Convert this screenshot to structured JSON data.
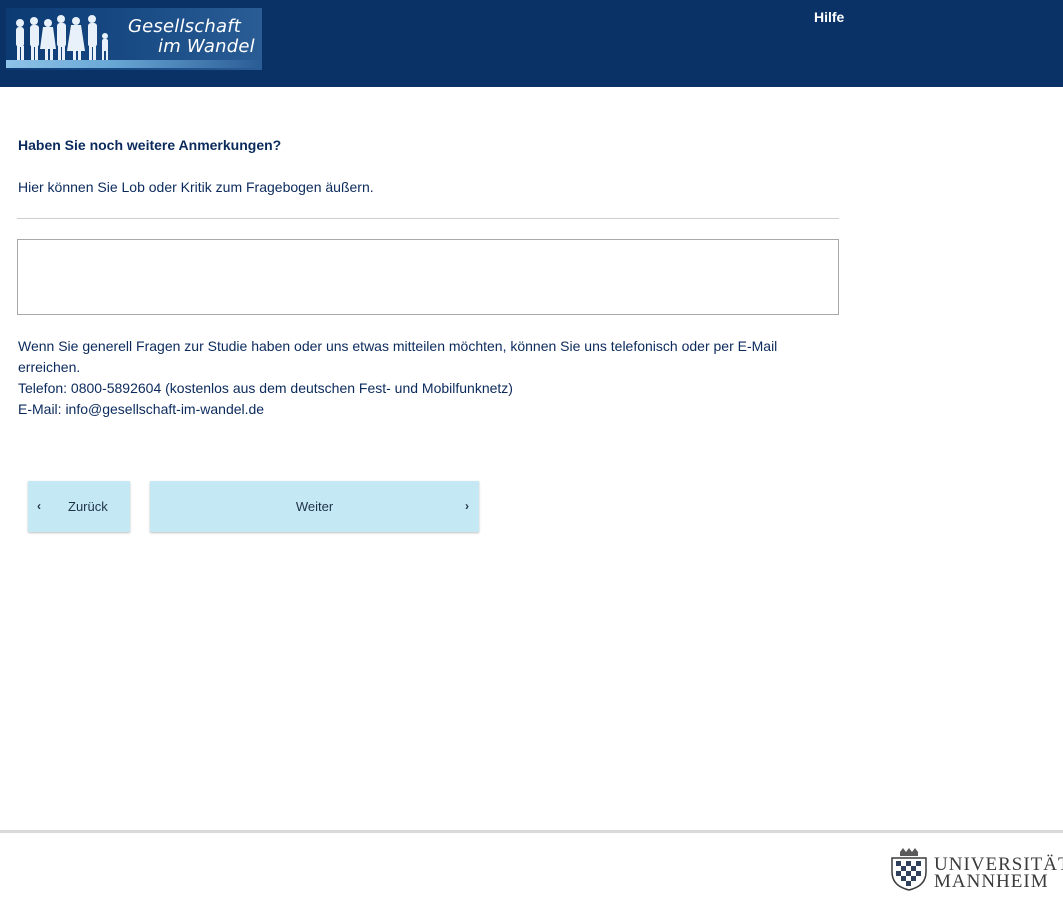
{
  "header": {
    "logo_line1": "Gesellschaft",
    "logo_line2": "im Wandel",
    "help_label": "Hilfe"
  },
  "question": {
    "title": "Haben Sie noch weitere Anmerkungen?",
    "subtitle": "Hier können Sie Lob oder Kritik zum Fragebogen äußern.",
    "comment_value": ""
  },
  "info": {
    "line1": "Wenn Sie generell Fragen zur Studie haben oder uns etwas mitteilen möchten, können Sie uns telefonisch oder per E-Mail",
    "line2": "erreichen.",
    "line3": "Telefon: 0800-5892604 (kostenlos aus dem deutschen Fest- und Mobilfunknetz)",
    "line4": "E-Mail: info@gesellschaft-im-wandel.de"
  },
  "buttons": {
    "back_label": "Zurück",
    "next_label": "Weiter",
    "back_icon": "chevron-left-icon",
    "next_icon": "chevron-right-icon"
  },
  "footer": {
    "uni_line1": "UNIVERSITÄT",
    "uni_line2": "MANNHEIM"
  },
  "colors": {
    "header_bg": "#0a3266",
    "text": "#0b2a5c",
    "button_bg": "#c5e8f5"
  }
}
